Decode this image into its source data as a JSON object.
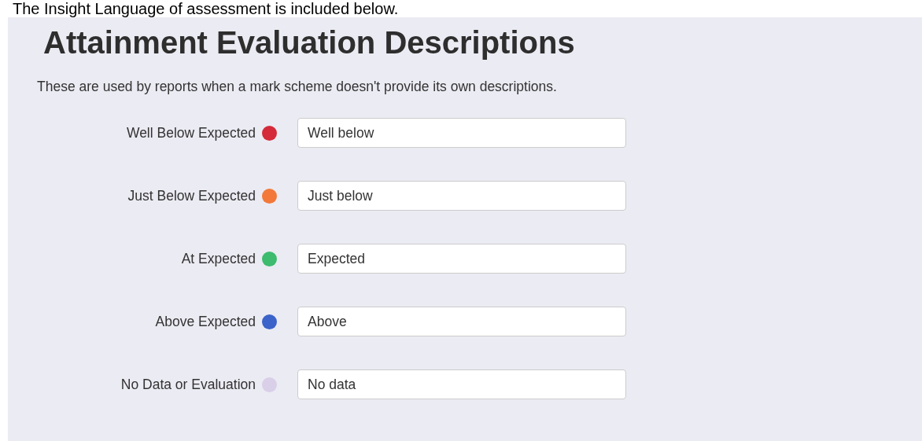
{
  "intro": "The Insight Language of assessment is included below.",
  "title": "Attainment Evaluation Descriptions",
  "description": "These are used by reports when a mark scheme doesn't provide its own descriptions.",
  "levels": [
    {
      "label": "Well Below Expected",
      "color": "#d42a3a",
      "value": "Well below"
    },
    {
      "label": "Just Below Expected",
      "color": "#f2793a",
      "value": "Just below"
    },
    {
      "label": "At Expected",
      "color": "#3dbb6e",
      "value": "Expected"
    },
    {
      "label": "Above Expected",
      "color": "#3b63c9",
      "value": "Above"
    },
    {
      "label": "No Data or Evaluation",
      "color": "#d9cfe8",
      "value": "No data"
    }
  ]
}
